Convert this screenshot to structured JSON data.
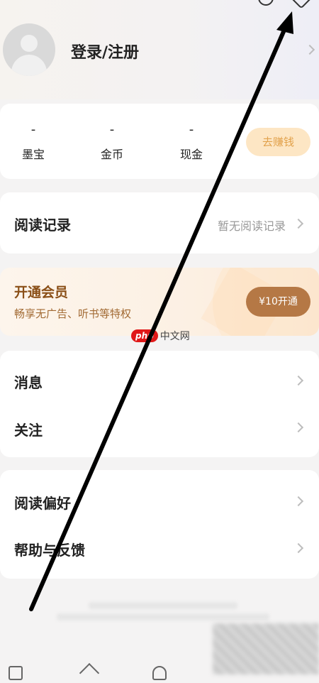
{
  "profile": {
    "login_label": "登录/注册"
  },
  "stats": [
    {
      "value": "-",
      "label": "墨宝"
    },
    {
      "value": "-",
      "label": "金币"
    },
    {
      "value": "-",
      "label": "现金"
    }
  ],
  "earn_button": "去赚钱",
  "reading_record": {
    "title": "阅读记录",
    "status": "暂无阅读记录"
  },
  "vip": {
    "title": "开通会员",
    "subtitle": "畅享无广告、听书等特权",
    "button": "¥10开通"
  },
  "menu_group_1": [
    {
      "label": "消息"
    },
    {
      "label": "关注"
    }
  ],
  "menu_group_2": [
    {
      "label": "阅读偏好"
    },
    {
      "label": "帮助与反馈"
    }
  ],
  "watermark": {
    "logo": "php",
    "text": "中文网"
  },
  "colors": {
    "accent_vip": "#b57845",
    "earn_bg": "#fde6c4",
    "earn_text": "#e2a24c",
    "annotation_arrow": "#000000"
  }
}
